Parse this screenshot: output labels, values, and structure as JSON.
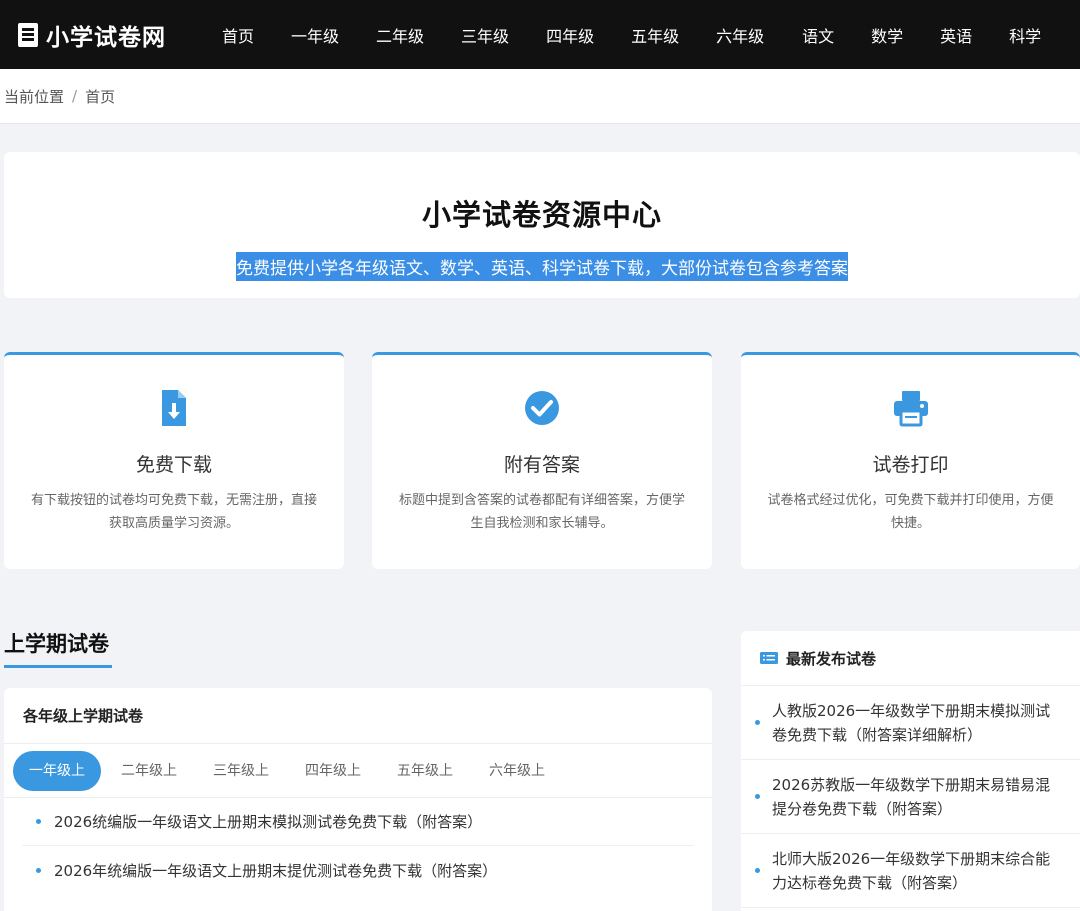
{
  "header": {
    "logo_text": "小学试卷网",
    "nav": [
      "首页",
      "一年级",
      "二年级",
      "三年级",
      "四年级",
      "五年级",
      "六年级",
      "语文",
      "数学",
      "英语",
      "科学"
    ]
  },
  "breadcrumb": {
    "current_label": "当前位置",
    "separator": "/",
    "home": "首页"
  },
  "hero": {
    "title": "小学试卷资源中心",
    "subtitle": "免费提供小学各年级语文、数学、英语、科学试卷下载，大部份试卷包含参考答案"
  },
  "features": [
    {
      "icon": "file-download-icon",
      "title": "免费下载",
      "desc": "有下载按钮的试卷均可免费下载，无需注册，直接获取高质量学习资源。"
    },
    {
      "icon": "check-circle-icon",
      "title": "附有答案",
      "desc": "标题中提到含答案的试卷都配有详细答案，方便学生自我检测和家长辅导。"
    },
    {
      "icon": "printer-icon",
      "title": "试卷打印",
      "desc": "试卷格式经过优化，可免费下载并打印使用，方便快捷。"
    }
  ],
  "section": {
    "title": "上学期试卷"
  },
  "panel": {
    "title": "各年级上学期试卷",
    "tabs": [
      "一年级上",
      "二年级上",
      "三年级上",
      "四年级上",
      "五年级上",
      "六年级上"
    ],
    "active_tab": "一年级上",
    "items": [
      "2026统编版一年级语文上册期末模拟测试卷免费下载（附答案）",
      "2026年统编版一年级语文上册期末提优测试卷免费下载（附答案）"
    ]
  },
  "sidebar": {
    "title": "最新发布试卷",
    "icon": "list-icon",
    "items": [
      "人教版2026一年级数学下册期末模拟测试卷免费下载（附答案详细解析）",
      "2026苏教版一年级数学下册期末易错易混提分卷免费下载（附答案）",
      "北师大版2026一年级数学下册期末综合能力达标卷免费下载（附答案）"
    ]
  },
  "colors": {
    "header_bg": "#111111",
    "accent": "#3a98e0",
    "page_bg": "#f2f3f6",
    "highlight": "#3a8ee6"
  }
}
